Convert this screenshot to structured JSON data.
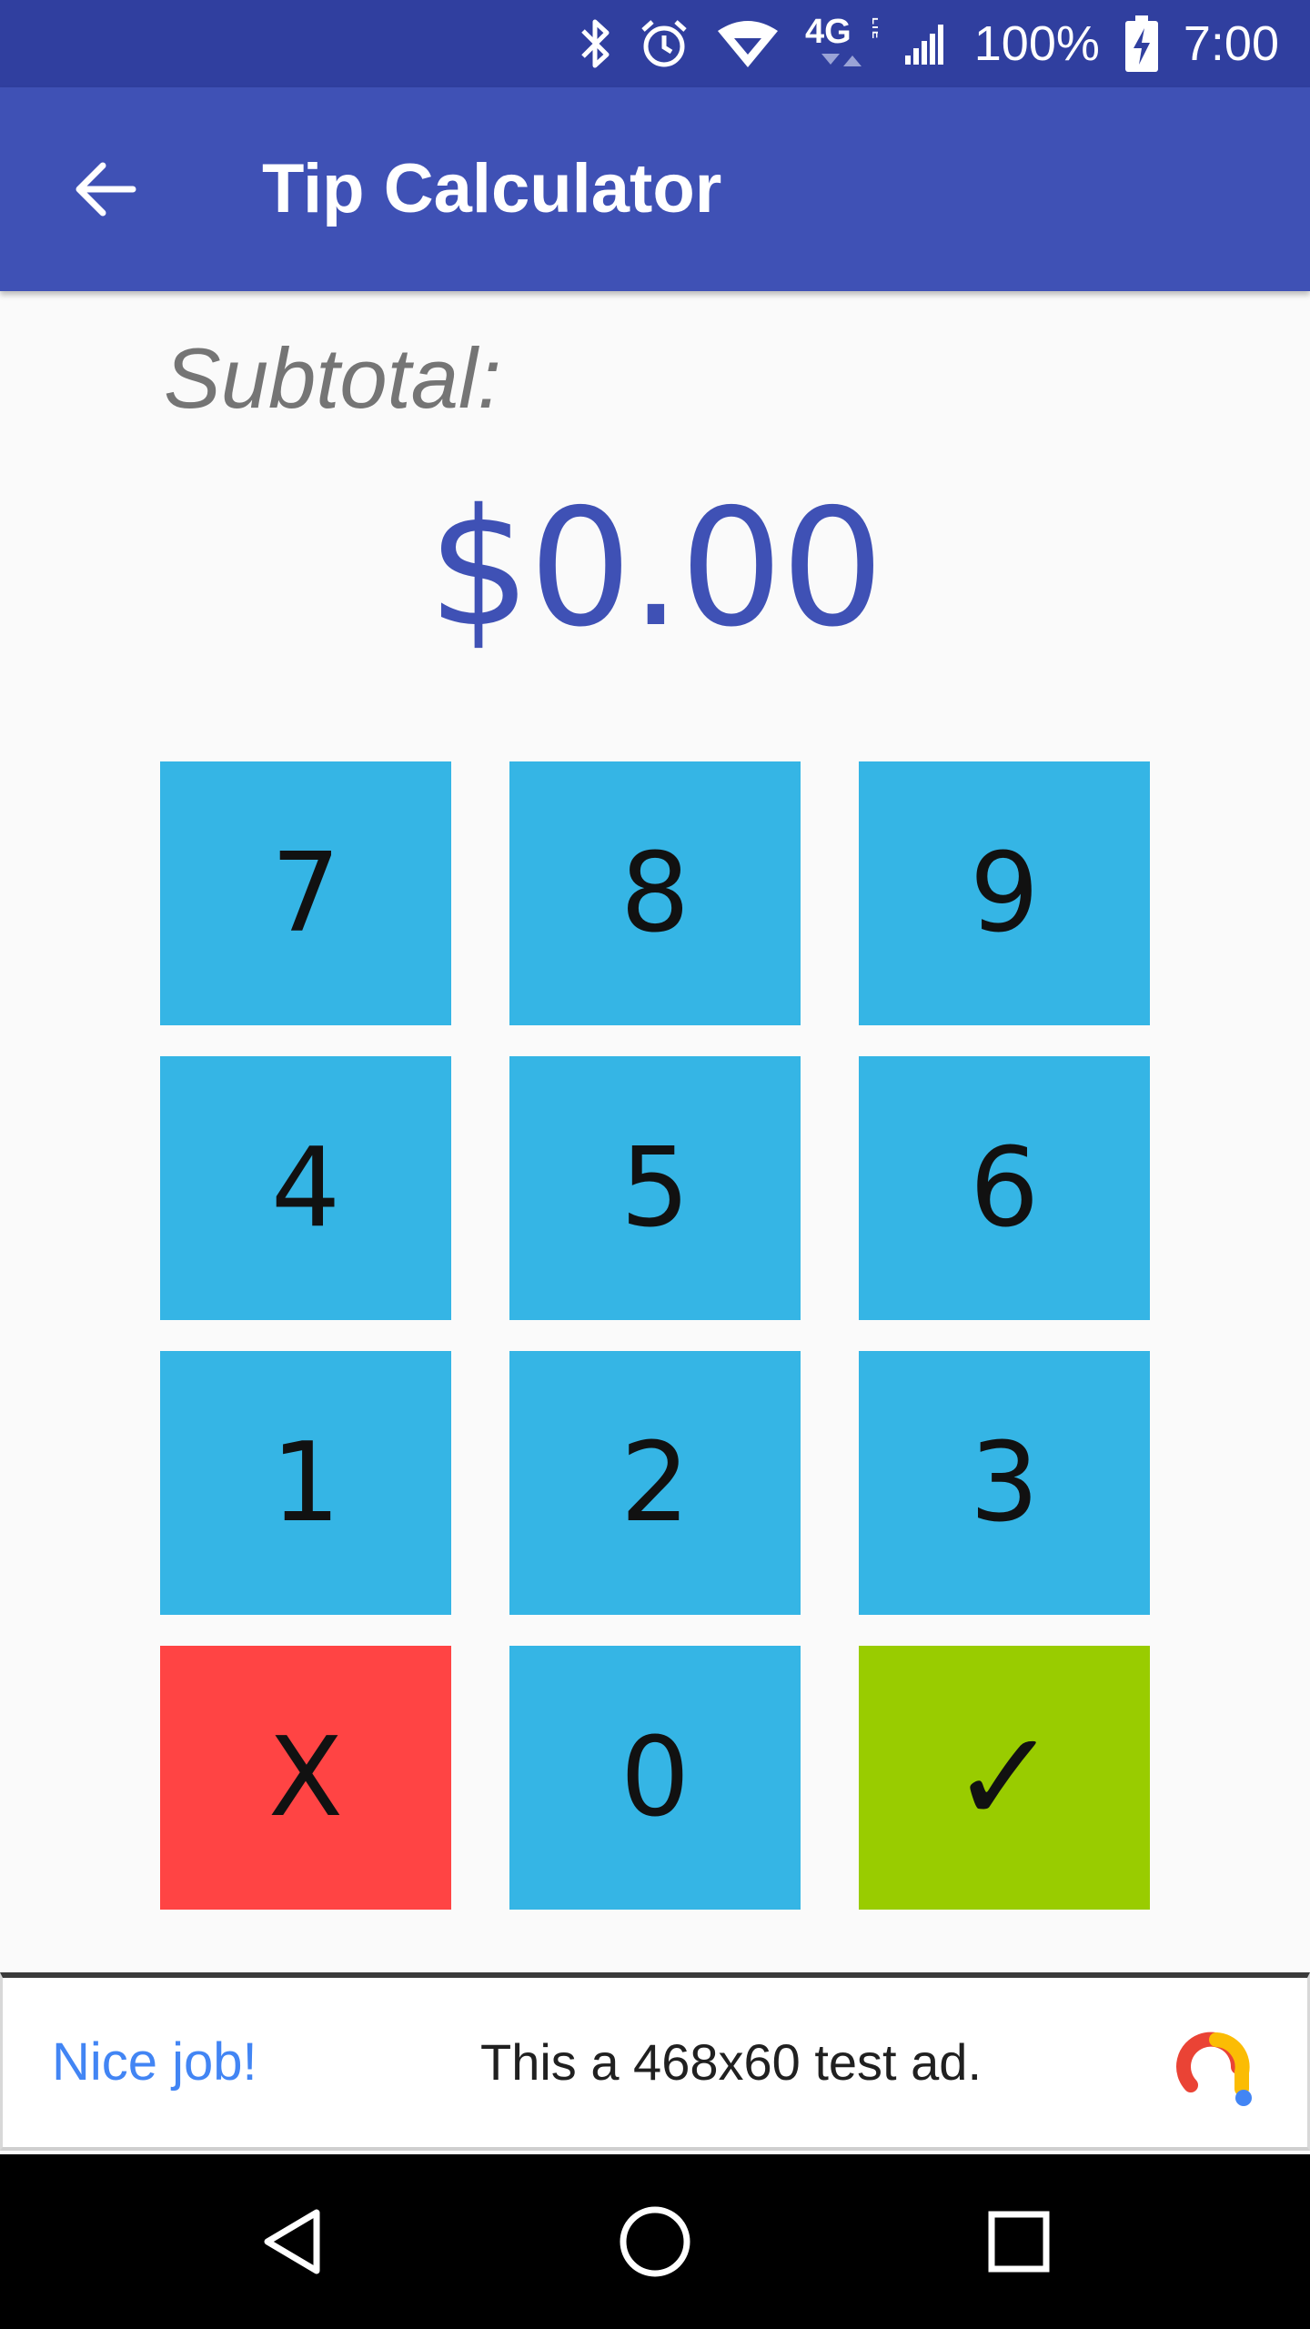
{
  "status_bar": {
    "battery_percent": "100%",
    "time": "7:00",
    "network_label": "4G",
    "network_sub_label": "LTE",
    "icons": [
      "bluetooth-icon",
      "alarm-icon",
      "wifi-icon",
      "4g-lte-icon",
      "signal-icon",
      "battery-charging-icon"
    ]
  },
  "app_bar": {
    "title": "Tip Calculator",
    "back_icon": "arrow-back-icon"
  },
  "content": {
    "subtotal_label": "Subtotal:",
    "amount": "$0.00"
  },
  "keypad": {
    "keys": [
      {
        "label": "7",
        "color": "#35b5e5"
      },
      {
        "label": "8",
        "color": "#35b5e5"
      },
      {
        "label": "9",
        "color": "#35b5e5"
      },
      {
        "label": "4",
        "color": "#35b5e5"
      },
      {
        "label": "5",
        "color": "#35b5e5"
      },
      {
        "label": "6",
        "color": "#35b5e5"
      },
      {
        "label": "1",
        "color": "#35b5e5"
      },
      {
        "label": "2",
        "color": "#35b5e5"
      },
      {
        "label": "3",
        "color": "#35b5e5"
      },
      {
        "label": "X",
        "color": "#ff4444"
      },
      {
        "label": "0",
        "color": "#35b5e5"
      },
      {
        "label": "✓",
        "color": "#99cc00"
      }
    ]
  },
  "ad": {
    "headline": "Nice job!",
    "body": "This a 468x60 test ad.",
    "logo_icon": "ad-logo-icon"
  },
  "nav_bar": {
    "icons": [
      "back-triangle-icon",
      "home-circle-icon",
      "recents-square-icon"
    ]
  },
  "colors": {
    "status_bar": "#303f9f",
    "app_bar": "#3f51b5",
    "amount_text": "#3f51b5",
    "key_blue": "#35b5e5",
    "key_red": "#ff4444",
    "key_green": "#99cc00"
  }
}
